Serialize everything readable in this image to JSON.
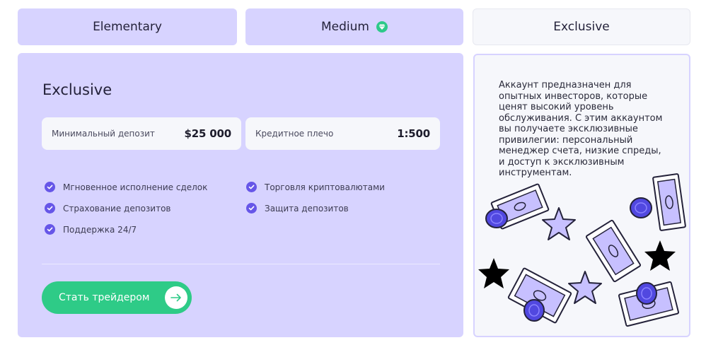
{
  "tabs": {
    "elementary": "Elementary",
    "medium": "Medium",
    "exclusive": "Exclusive"
  },
  "panel": {
    "title": "Exclusive",
    "min_deposit_label": "Минимальный депозит",
    "min_deposit_value": "$25 000",
    "leverage_label": "Кредитное плечо",
    "leverage_value": "1:500",
    "features": [
      "Мгновенное исполнение сделок",
      "Страхование депозитов",
      "Поддержка 24/7",
      "Торговля криптовалютами",
      "Защита депозитов"
    ],
    "cta_label": "Стать трейдером"
  },
  "description": "Аккаунт предназначен для опытных инвесторов, которые ценят высокий уровень обслуживания. С этим аккаунтом вы получаете эксклюзивные привилегии: персональный менеджер счета, низкие спреды, и доступ к эксклюзивным инструментам.",
  "icons": {
    "medium_badge": "gem-icon",
    "feature_check": "check-circle-icon",
    "cta": "arrow-right-icon"
  },
  "colors": {
    "lavender": "#d7d3ff",
    "accent_purple": "#6656e8",
    "green": "#2ecb87",
    "card_bg": "#f6f7fb"
  }
}
